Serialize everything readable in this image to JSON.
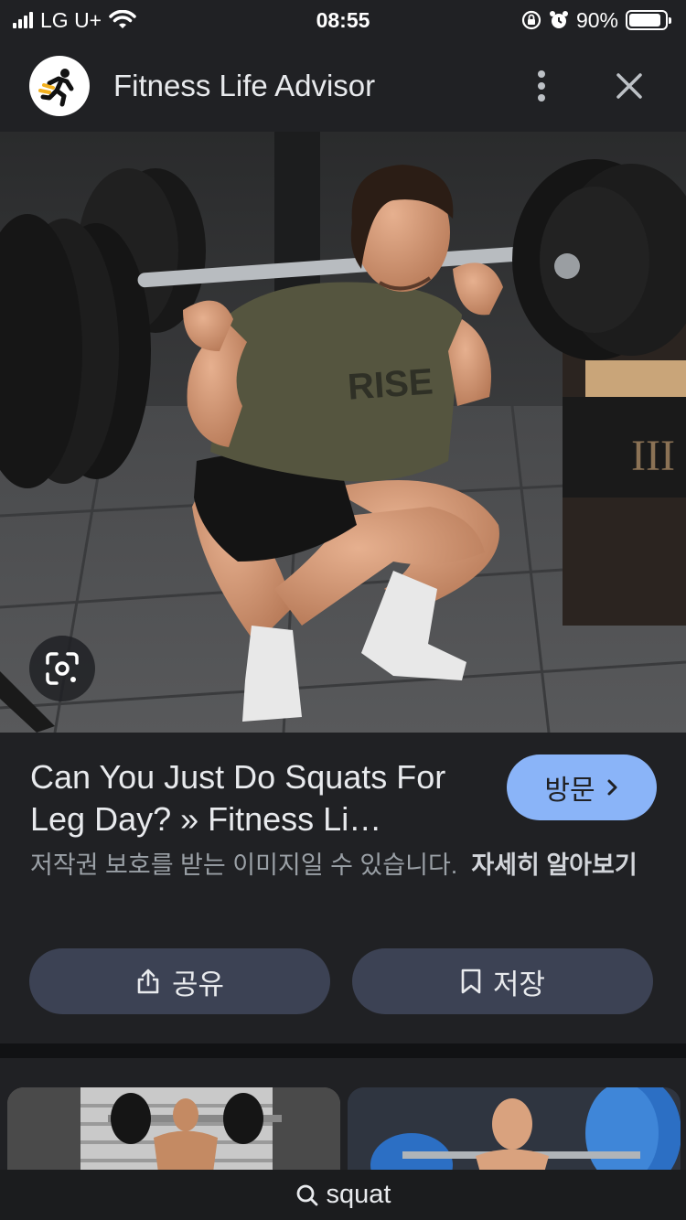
{
  "status_bar": {
    "carrier": "LG U+",
    "time": "08:55",
    "battery_percent": "90%",
    "battery_level": 0.9
  },
  "app_bar": {
    "site_name": "Fitness Life Advisor",
    "logo_icon": "runner-logo-icon",
    "menu_icon": "more-vert-icon",
    "close_icon": "close-icon"
  },
  "hero": {
    "shirt_text": "RISE",
    "lens_icon": "google-lens-icon"
  },
  "result": {
    "title": "Can You Just Do Squats For Leg Day? » Fitness Li…",
    "visit_label": "방문",
    "copyright_notice": "저작권 보호를 받는 이미지일 수 있습니다.",
    "learn_more": "자세히 알아보기"
  },
  "actions": {
    "share_label": "공유",
    "save_label": "저장"
  },
  "search": {
    "query": "squat"
  },
  "colors": {
    "background": "#202124",
    "visit_button": "#8ab4f8",
    "action_button": "#3c4254",
    "secondary_text": "#9aa0a6"
  }
}
